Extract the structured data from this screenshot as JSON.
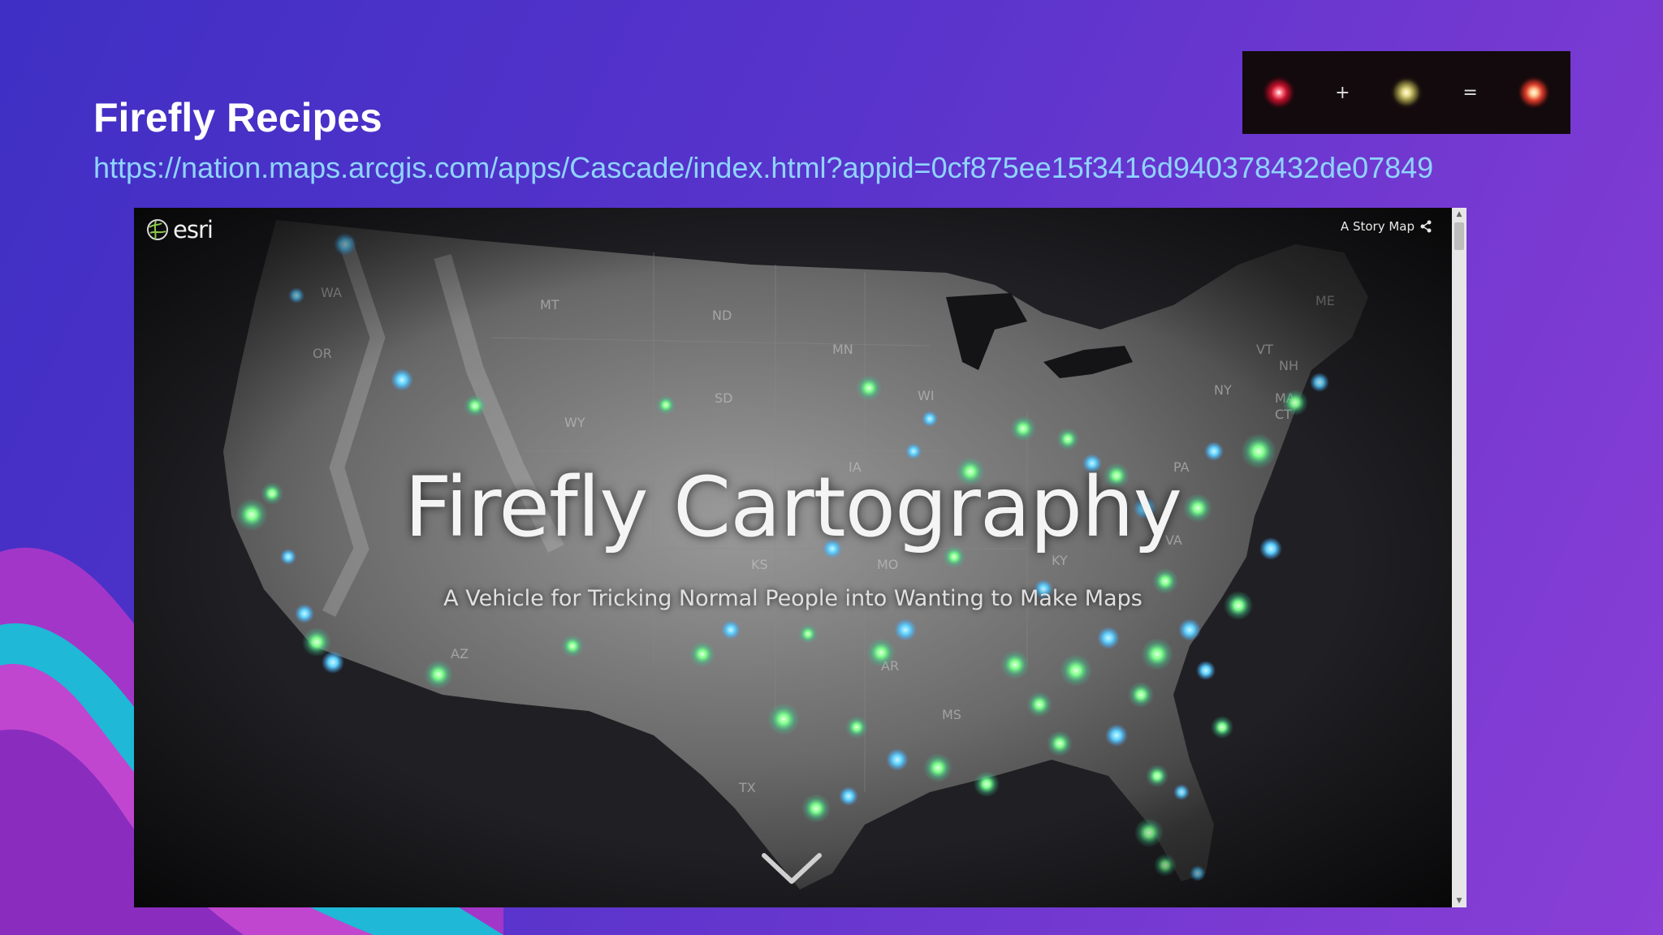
{
  "slide": {
    "title": "Firefly Recipes",
    "link": "https://nation.maps.arcgis.com/apps/Cascade/index.html?appid=0cf875ee15f3416d940378432de07849"
  },
  "formula": {
    "plus": "+",
    "equals": "=",
    "colors": [
      "#c0102a",
      "#e6dc8a",
      "#ffb080"
    ]
  },
  "embed": {
    "logo_text": "esri",
    "badge_text": "A Story Map",
    "hero_title": "Firefly Cartography",
    "hero_subtitle": "A Vehicle for Tricking Normal People into Wanting to Make Maps",
    "state_labels": [
      "ND",
      "MN",
      "SD",
      "WI",
      "IA",
      "MO",
      "KS",
      "KY",
      "VA",
      "PA",
      "NY",
      "VT",
      "NH",
      "ME",
      "MA",
      "CT",
      "AR",
      "MS",
      "TX",
      "WA",
      "OR",
      "WY",
      "AZ",
      "MT"
    ],
    "firefly_color": "#7dff8a",
    "glow_color": "#5fd4ff"
  }
}
